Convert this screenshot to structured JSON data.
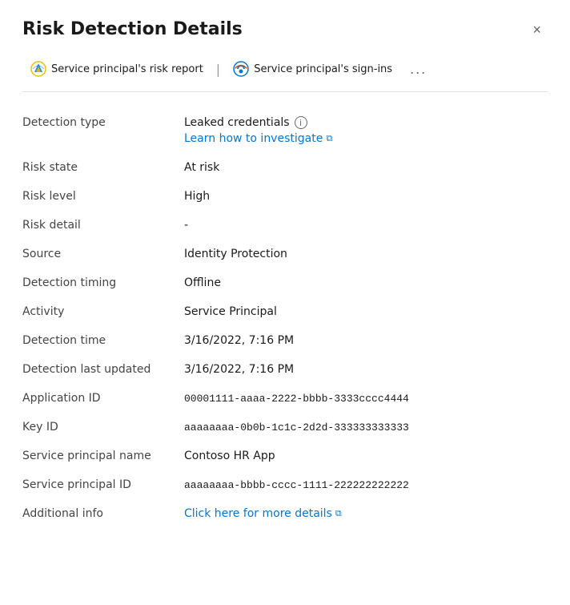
{
  "panel": {
    "title": "Risk Detection Details",
    "close_label": "×"
  },
  "toolbar": {
    "risk_report_label": "Service principal's risk report",
    "sign_ins_label": "Service principal's sign-ins",
    "more_label": "..."
  },
  "fields": [
    {
      "label": "Detection type",
      "value": "Leaked credentials",
      "type": "detection_type",
      "link_label": "Learn how to investigate",
      "info": true
    },
    {
      "label": "Risk state",
      "value": "At risk",
      "type": "text"
    },
    {
      "label": "Risk level",
      "value": "High",
      "type": "text"
    },
    {
      "label": "Risk detail",
      "value": "-",
      "type": "text"
    },
    {
      "label": "Source",
      "value": "Identity Protection",
      "type": "text"
    },
    {
      "label": "Detection timing",
      "value": "Offline",
      "type": "text"
    },
    {
      "label": "Activity",
      "value": "Service Principal",
      "type": "text"
    },
    {
      "label": "Detection time",
      "value": "3/16/2022, 7:16 PM",
      "type": "text"
    },
    {
      "label": "Detection last updated",
      "value": "3/16/2022, 7:16 PM",
      "type": "text"
    },
    {
      "label": "Application ID",
      "value": "00001111-aaaa-2222-bbbb-3333cccc4444",
      "type": "monospace"
    },
    {
      "label": "Key ID",
      "value": "aaaaaaaa-0b0b-1c1c-2d2d-333333333333",
      "type": "monospace"
    },
    {
      "label": "Service principal name",
      "value": "Contoso HR App",
      "type": "text"
    },
    {
      "label": "Service principal ID",
      "value": "aaaaaaaa-bbbb-cccc-1111-222222222222",
      "type": "monospace"
    },
    {
      "label": "Additional info",
      "value": "Click here for more details",
      "type": "link"
    }
  ],
  "icons": {
    "info": "ℹ",
    "external": "↗",
    "close": "✕"
  },
  "colors": {
    "link": "#0078d4",
    "label": "#444444",
    "border": "#e0e0e0",
    "title": "#1a1a1a"
  }
}
